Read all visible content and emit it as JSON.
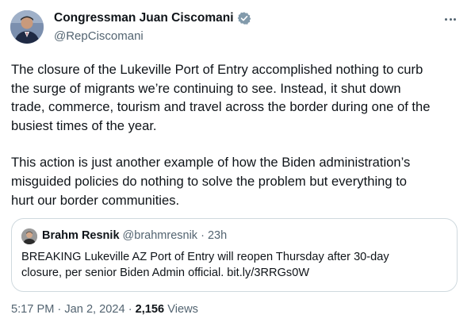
{
  "author": {
    "name": "Congressman Juan Ciscomani",
    "handle": "@RepCiscomani",
    "verified_color": "#829aab",
    "avatar_icon": "avatar-portrait"
  },
  "more_icon": "more-horizontal-icon",
  "body": {
    "paragraph1": [
      "The closure of the Lukeville Port of Entry accomplished nothing to curb",
      "the surge of migrants we’re continuing to see. Instead, it shut down",
      "trade, commerce, tourism and travel across the border during one of the",
      "busiest times of the year."
    ],
    "paragraph2": [
      "This action is just another example of how the Biden administration’s",
      "misguided policies do nothing to solve the problem but everything to",
      "hurt our border communities."
    ]
  },
  "quote": {
    "name": "Brahm Resnik",
    "handle": "@brahmresnik",
    "separator": "·",
    "time": "23h",
    "lines": [
      "BREAKING  Lukeville AZ Port of Entry will reopen Thursday after 30-day",
      "closure, per senior Biden Admin official. bit.ly/3RRGs0W"
    ]
  },
  "footer": {
    "time": "5:17 PM",
    "sep1": "·",
    "date": "Jan 2, 2024",
    "sep2": "·",
    "views_count": "2,156",
    "views_label": "Views"
  },
  "colors": {
    "text_primary": "#0f1419",
    "text_secondary": "#536471",
    "border": "#cfd9de"
  }
}
